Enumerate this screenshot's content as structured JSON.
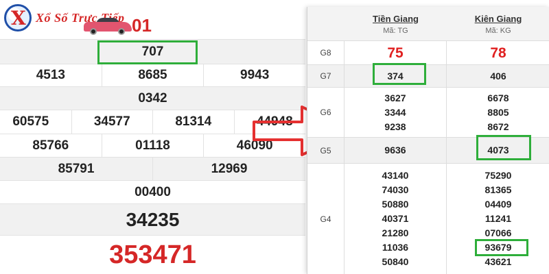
{
  "logo": {
    "text": "Xổ Số Trực Tiếp"
  },
  "left_table": {
    "header_partial_number": "01",
    "rows": [
      {
        "values": [
          "707"
        ]
      },
      {
        "values": [
          "4513",
          "8685",
          "9943"
        ]
      },
      {
        "values": [
          "0342"
        ]
      },
      {
        "values": [
          "60575",
          "34577",
          "81314",
          "44948"
        ]
      },
      {
        "values": [
          "85766",
          "01118",
          "46090"
        ]
      },
      {
        "values": [
          "85791",
          "12969"
        ]
      },
      {
        "values": [
          "00400"
        ]
      },
      {
        "values": [
          "34235"
        ]
      },
      {
        "values": [
          "353471"
        ]
      }
    ]
  },
  "right_table": {
    "columns": [
      {
        "province": "Tiền Giang",
        "code": "Mã: TG"
      },
      {
        "province": "Kiên Giang",
        "code": "Mã: KG"
      }
    ],
    "rows": [
      {
        "label": "G8",
        "values": [
          [
            "75"
          ],
          [
            "78"
          ]
        ]
      },
      {
        "label": "G7",
        "values": [
          [
            "374"
          ],
          [
            "406"
          ]
        ]
      },
      {
        "label": "G6",
        "values": [
          [
            "3627",
            "3344",
            "9238"
          ],
          [
            "6678",
            "8805",
            "8672"
          ]
        ]
      },
      {
        "label": "G5",
        "values": [
          [
            "9636"
          ],
          [
            "4073"
          ]
        ]
      },
      {
        "label": "G4",
        "values": [
          [
            "43140",
            "74030",
            "50880",
            "40371",
            "21280",
            "11036",
            "50840"
          ],
          [
            "75290",
            "81365",
            "04409",
            "11241",
            "07066",
            "93679",
            "43621"
          ]
        ]
      }
    ]
  },
  "colors": {
    "red": "#e02020",
    "highlight_green": "#2eae3a",
    "arrow_red": "#e53030"
  },
  "icons": {
    "logo": "xo-so-logo-icon",
    "car": "car-icon",
    "arrow": "right-arrow-icon"
  }
}
